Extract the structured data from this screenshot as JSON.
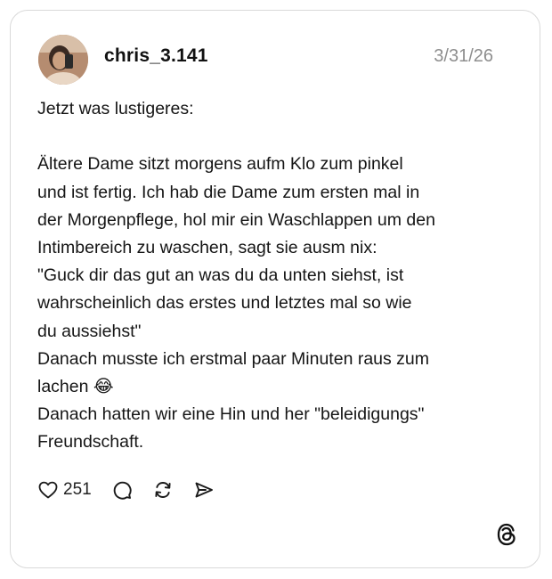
{
  "post": {
    "username": "chris_3.141",
    "date": "3/31/26",
    "text_lines": [
      "Jetzt was lustigeres:",
      "",
      "Ältere Dame sitzt morgens aufm Klo zum pinkel",
      "und ist fertig. Ich hab die Dame zum ersten mal in",
      "der Morgenpflege, hol mir ein Waschlappen um den",
      "Intimbereich zu waschen, sagt sie ausm nix:",
      "\"Guck dir das gut an was du da unten siehst, ist",
      "wahrscheinlich das erstes und letztes mal so wie",
      "du aussiehst\"",
      "Danach musste ich erstmal paar Minuten raus zum",
      "lachen 😂",
      "Danach hatten wir eine Hin und her \"beleidigungs\"",
      "Freundschaft."
    ]
  },
  "actions": {
    "like_count": "251",
    "icons": [
      "heart-icon",
      "comment-icon",
      "repost-icon",
      "share-icon"
    ]
  },
  "branding": {
    "logo": "threads-logo-icon"
  }
}
